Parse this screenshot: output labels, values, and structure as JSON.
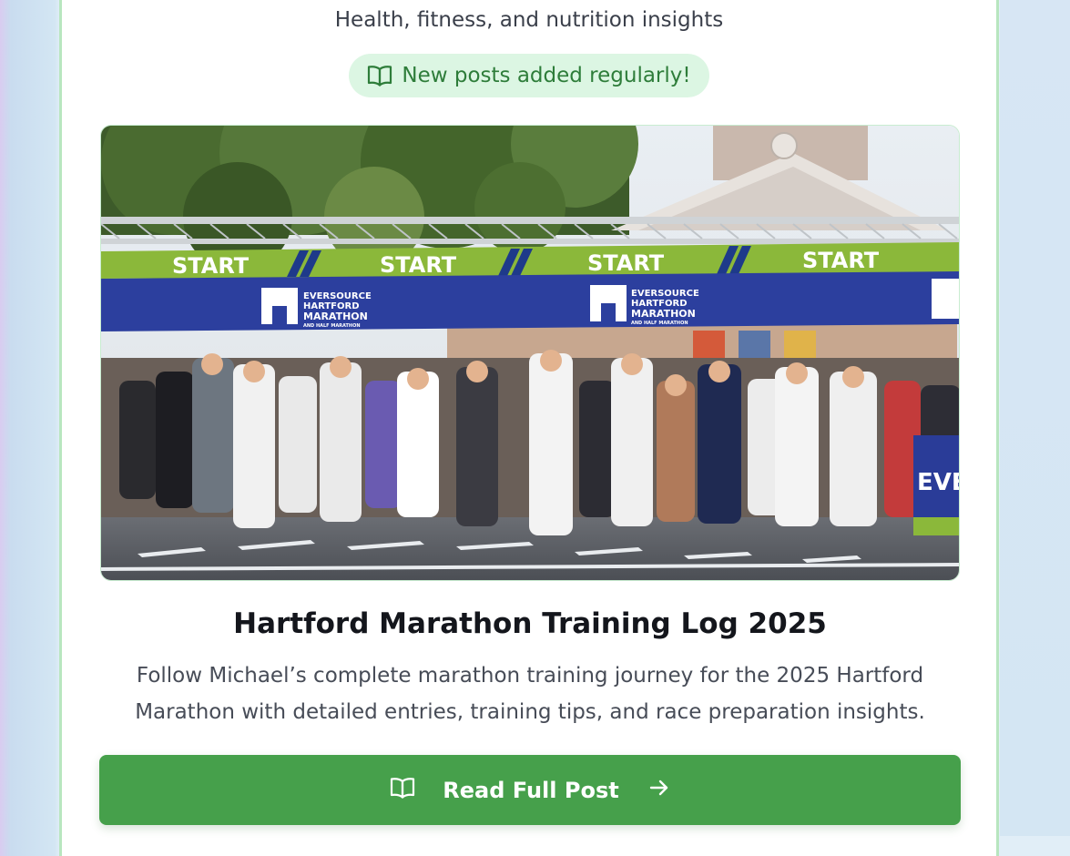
{
  "header": {
    "subtitle": "Health, fitness, and nutrition insights",
    "badge_icon": "book-open-icon",
    "badge_text": "New posts added regularly!"
  },
  "post": {
    "image_alt": "Runners at the start line of the Eversource Hartford Marathon",
    "banner_start_label": "START",
    "banner_brand_line1": "EVERSOURCE",
    "banner_brand_line2": "HARTFORD",
    "banner_brand_line3": "MARATHON",
    "banner_brand_line4": "AND HALF MARATHON",
    "banner_side_text": "EVE",
    "title": "Hartford Marathon Training Log 2025",
    "description": "Follow Michael’s complete marathon training journey for the 2025 Hartford Marathon with detailed entries, training tips, and race preparation insights.",
    "button_label": "Read Full Post",
    "button_icon_left": "book-open-icon",
    "button_icon_right": "arrow-right-icon"
  },
  "colors": {
    "accent_green": "#46a04b",
    "badge_bg": "#dcf6e3",
    "badge_text": "#2e7d3a",
    "card_border": "#b8e6bf"
  }
}
